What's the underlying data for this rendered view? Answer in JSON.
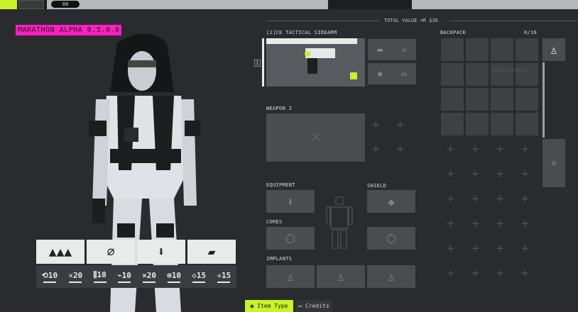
{
  "topbar": {
    "level": "00"
  },
  "version": "MARATHON ALPHA 0.5.0.0",
  "total_value": "TOTAL VALUE ¤R $30",
  "weapon1": {
    "index": "[1]",
    "name": "CE TACTICAL SIDEARM",
    "side_index": "1"
  },
  "weapon2": {
    "label": "WEAPON 2"
  },
  "equipment": {
    "label": "EQUIPMENT"
  },
  "shield": {
    "label": "SHIELD"
  },
  "cores": {
    "label": "CORES"
  },
  "implants": {
    "label": "IMPLANTS"
  },
  "backpack": {
    "label": "BACKPACK",
    "count": "0/16"
  },
  "backpack_id": "F8974077A4679549",
  "stats": [
    {
      "icon": "⟲",
      "value": "10"
    },
    {
      "icon": "✕",
      "value": "20"
    },
    {
      "icon": "⫼",
      "value": "10"
    },
    {
      "icon": "⌁",
      "value": "10"
    },
    {
      "icon": "×",
      "value": "20"
    },
    {
      "icon": "⊕",
      "value": "10"
    },
    {
      "icon": "◇",
      "value": "15"
    },
    {
      "icon": "✛",
      "value": "15"
    }
  ],
  "abilities": [
    "▲▲▲",
    "⌀",
    "⬇",
    "▰"
  ],
  "tabs": {
    "item_type": "Item Type",
    "credits": "Credits"
  },
  "colors": {
    "accent": "#c8f22a",
    "version_tag": "#ff1fc3",
    "bg": "#2a2b2e"
  }
}
